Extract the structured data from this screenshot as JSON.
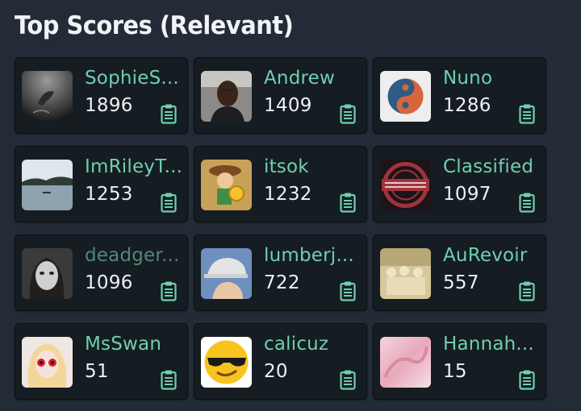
{
  "header": {
    "title": "Top Scores (Relevant)"
  },
  "colors": {
    "background": "#232c36",
    "card": "#151c22",
    "name": "#6fcfae",
    "score": "#eef1f3",
    "icon": "#6fcfae"
  },
  "entries": [
    {
      "name": "SophieS...",
      "score": "1896",
      "avatar": "diver-avatar"
    },
    {
      "name": "Andrew",
      "score": "1409",
      "avatar": "man-portrait-avatar"
    },
    {
      "name": "Nuno",
      "score": "1286",
      "avatar": "yin-yang-card-avatar"
    },
    {
      "name": "ImRileyT...",
      "score": "1253",
      "avatar": "lake-avatar"
    },
    {
      "name": "itsok",
      "score": "1232",
      "avatar": "cartoon-coin-avatar"
    },
    {
      "name": "Classified",
      "score": "1097",
      "avatar": "classified-stamp-avatar"
    },
    {
      "name": "deadger...",
      "score": "1096",
      "avatar": "doll-face-avatar"
    },
    {
      "name": "lumberj...",
      "score": "722",
      "avatar": "cap-person-avatar"
    },
    {
      "name": "AuRevoir",
      "score": "557",
      "avatar": "sepia-crowd-avatar"
    },
    {
      "name": "MsSwan",
      "score": "51",
      "avatar": "blonde-doll-avatar"
    },
    {
      "name": "calicuz",
      "score": "20",
      "avatar": "sunglasses-emoji-avatar"
    },
    {
      "name": "Hannah...",
      "score": "15",
      "avatar": "pink-abstract-avatar"
    }
  ]
}
